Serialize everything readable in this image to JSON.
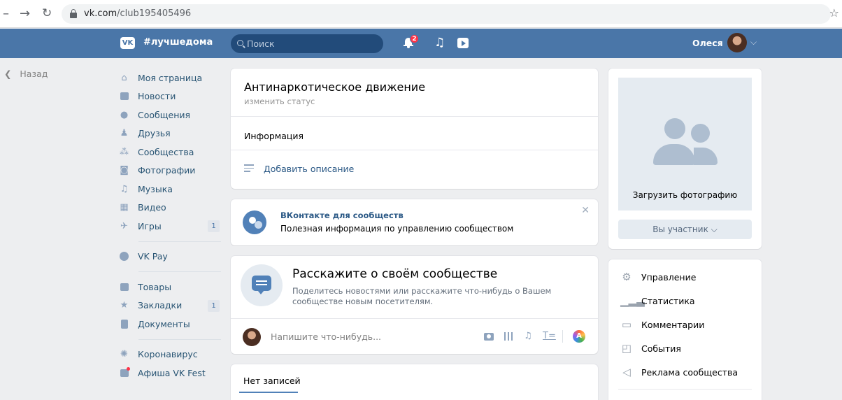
{
  "browser": {
    "url_host": "vk.com",
    "url_path": "/club195405496"
  },
  "header": {
    "logo_text": "VK",
    "hashtag": "#лучшедома",
    "search_placeholder": "Поиск",
    "notifications_count": "2",
    "user_name": "Олеся"
  },
  "back_label": "Назад",
  "sidebar": {
    "items": [
      {
        "label": "Моя страница",
        "icon": "home-icon"
      },
      {
        "label": "Новости",
        "icon": "news-icon"
      },
      {
        "label": "Сообщения",
        "icon": "messages-icon"
      },
      {
        "label": "Друзья",
        "icon": "friends-icon"
      },
      {
        "label": "Сообщества",
        "icon": "communities-icon"
      },
      {
        "label": "Фотографии",
        "icon": "photos-icon"
      },
      {
        "label": "Музыка",
        "icon": "music-icon"
      },
      {
        "label": "Видео",
        "icon": "video-icon"
      },
      {
        "label": "Игры",
        "icon": "games-icon",
        "count": "1"
      }
    ],
    "pay": {
      "label": "VK Pay",
      "icon": "vkpay-icon"
    },
    "items2": [
      {
        "label": "Товары",
        "icon": "goods-icon"
      },
      {
        "label": "Закладки",
        "icon": "bookmarks-icon",
        "count": "1"
      },
      {
        "label": "Документы",
        "icon": "documents-icon"
      }
    ],
    "items3": [
      {
        "label": "Коронавирус",
        "icon": "virus-icon"
      },
      {
        "label": "Афиша VK Fest",
        "icon": "afisha-icon"
      }
    ]
  },
  "group": {
    "title": "Антинаркотическое движение",
    "status_link": "изменить статус",
    "info_label": "Информация",
    "add_description": "Добавить описание"
  },
  "tip": {
    "title": "ВКонтакте для сообществ",
    "text": "Полезная информация по управлению сообществом",
    "close": "✕"
  },
  "tell": {
    "title": "Расскажите о своём сообществе",
    "text": "Поделитесь новостями или расскажите что-нибудь о Вашем сообществе новым посетителям.",
    "composer_placeholder": "Напишите что-нибудь..."
  },
  "wall": {
    "tab": "Нет записей"
  },
  "photo": {
    "upload_label": "Загрузить фотографию",
    "member_button": "Вы участник ⌵"
  },
  "manage_menu": [
    {
      "label": "Управление",
      "icon": "gear-icon"
    },
    {
      "label": "Статистика",
      "icon": "stats-icon"
    },
    {
      "label": "Комментарии",
      "icon": "comments-icon"
    },
    {
      "label": "События",
      "icon": "events-icon"
    },
    {
      "label": "Реклама сообщества",
      "icon": "megaphone-icon"
    }
  ],
  "colors": {
    "header_blue": "#4a76a8",
    "link_blue": "#2a5885",
    "page_bg": "#edeef0"
  }
}
